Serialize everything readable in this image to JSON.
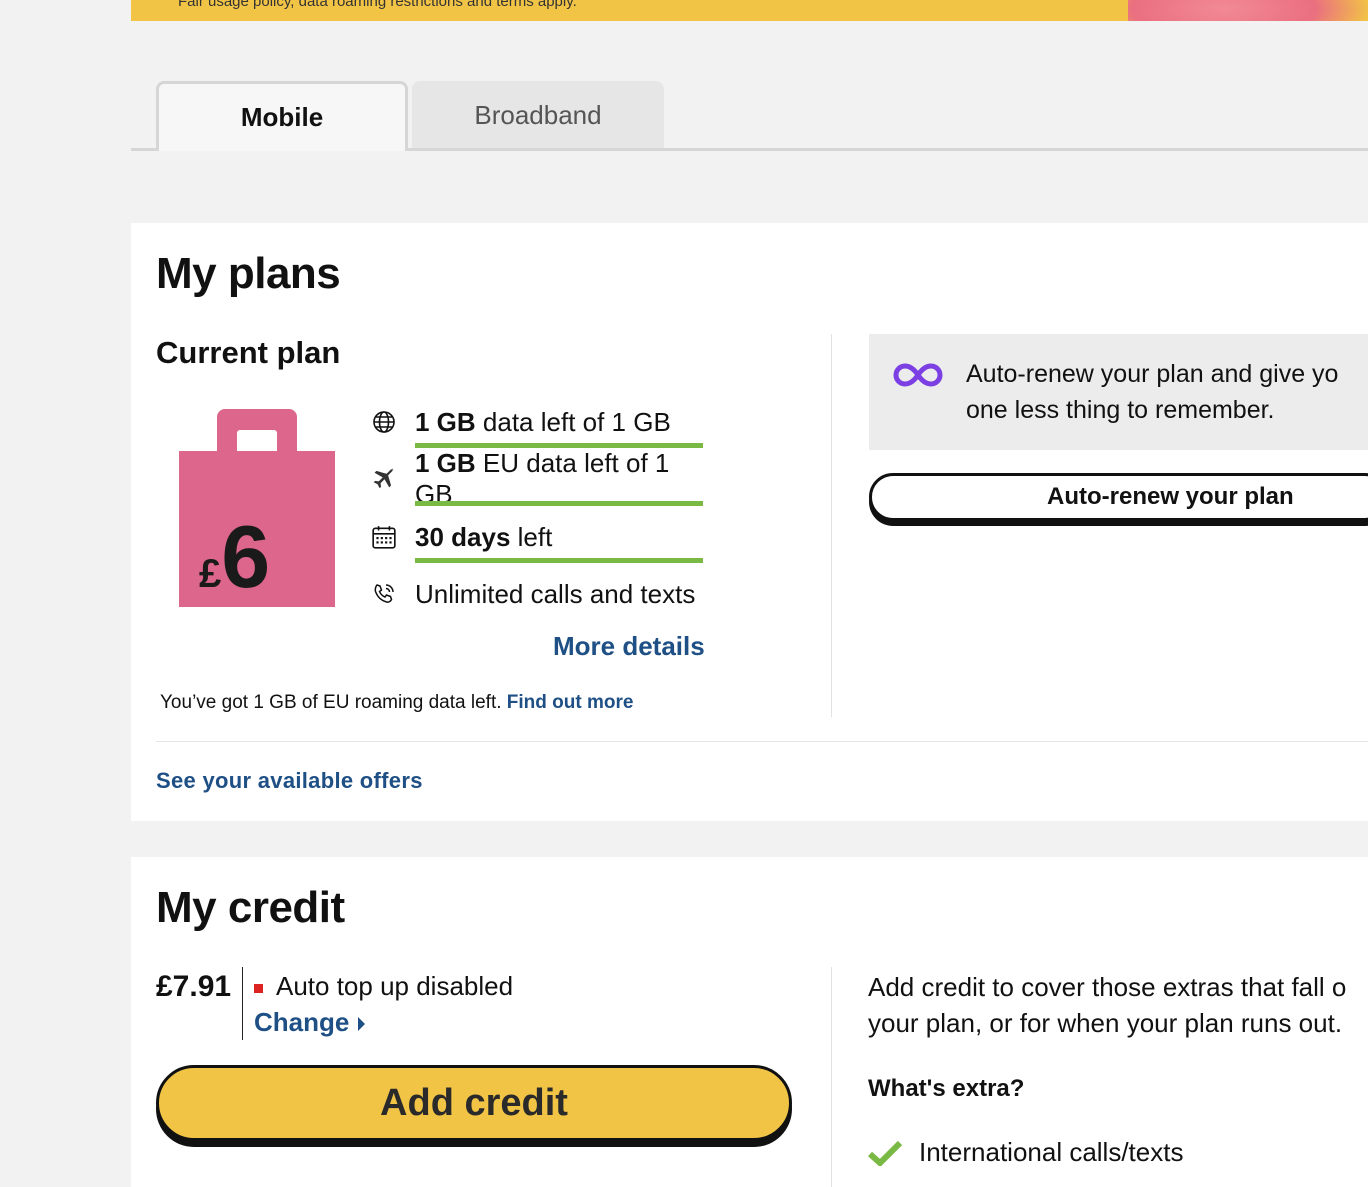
{
  "banner": {
    "text": "Fair usage policy, data roaming restrictions and terms apply."
  },
  "tabs": [
    {
      "label": "Mobile",
      "active": true
    },
    {
      "label": "Broadband",
      "active": false
    }
  ],
  "plans": {
    "title": "My plans",
    "current_plan_heading": "Current plan",
    "bag": {
      "currency": "£",
      "amount": "6",
      "color": "#dc668c"
    },
    "allowances": [
      {
        "icon": "globe-icon",
        "bold": "1 GB",
        "text": " data left of 1 GB",
        "bar_fill_percent": 100
      },
      {
        "icon": "plane-icon",
        "bold": "1 GB",
        "text": " EU data left of 1 GB",
        "bar_fill_percent": 100
      },
      {
        "icon": "calendar-icon",
        "bold": "30 days",
        "text": " left",
        "bar_fill_percent": 100
      },
      {
        "icon": "phone-icon",
        "bold": "",
        "text": "Unlimited calls and texts"
      }
    ],
    "more_details_label": "More details",
    "roaming_note": "You’ve got 1 GB of EU roaming data left.",
    "roaming_link": "Find out more",
    "offers_link": "See your available offers",
    "auto_renew": {
      "icon": "infinity-icon",
      "text_line1": "Auto-renew your plan and give yo",
      "text_line2": "one less thing to remember.",
      "button_label": "Auto-renew your plan"
    }
  },
  "credit": {
    "title": "My credit",
    "amount": "£7.91",
    "status": "Auto top up disabled",
    "change_label": "Change",
    "add_button_label": "Add credit",
    "desc_line1": "Add credit to cover those extras that fall o",
    "desc_line2": "your plan, or for when your plan runs out.",
    "extra_heading": "What's extra?",
    "extras": [
      "International calls/texts"
    ]
  },
  "colors": {
    "accent_yellow": "#f2c446",
    "link_blue": "#1e4f85",
    "bar_green": "#79b944",
    "infinity_purple": "#7b3fe4",
    "status_red": "#d22222"
  }
}
